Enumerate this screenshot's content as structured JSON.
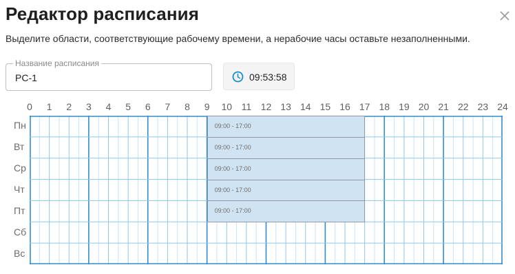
{
  "dialog": {
    "title": "Редактор расписания",
    "close_icon": "close-icon",
    "subtitle": "Выделите области, соответствующие рабочему времени, а нерабочие часы оставьте незаполненными."
  },
  "name_field": {
    "label": "Название расписания",
    "value": "PC-1"
  },
  "clock": {
    "icon": "clock-icon",
    "time": "09:53:58",
    "accent_color": "#1a8fc9"
  },
  "hours": [
    "0",
    "1",
    "2",
    "3",
    "4",
    "5",
    "6",
    "7",
    "8",
    "9",
    "10",
    "11",
    "12",
    "13",
    "14",
    "15",
    "16",
    "17",
    "18",
    "19",
    "20",
    "21",
    "22",
    "23",
    "24"
  ],
  "days": [
    "Пн",
    "Вт",
    "Ср",
    "Чт",
    "Пт",
    "Сб",
    "Вс"
  ],
  "blocks": [
    {
      "day": 0,
      "start": 9,
      "end": 17,
      "label": "09:00 - 17:00"
    },
    {
      "day": 1,
      "start": 9,
      "end": 17,
      "label": "09:00 - 17:00"
    },
    {
      "day": 2,
      "start": 9,
      "end": 17,
      "label": "09:00 - 17:00"
    },
    {
      "day": 3,
      "start": 9,
      "end": 17,
      "label": "09:00 - 17:00"
    },
    {
      "day": 4,
      "start": 9,
      "end": 17,
      "label": "09:00 - 17:00"
    }
  ],
  "colors": {
    "grid_line": "#8ec7ea",
    "grid_major": "#2f8dd0",
    "block_fill": "#cfe3f2",
    "block_border": "#8d9aa5"
  }
}
